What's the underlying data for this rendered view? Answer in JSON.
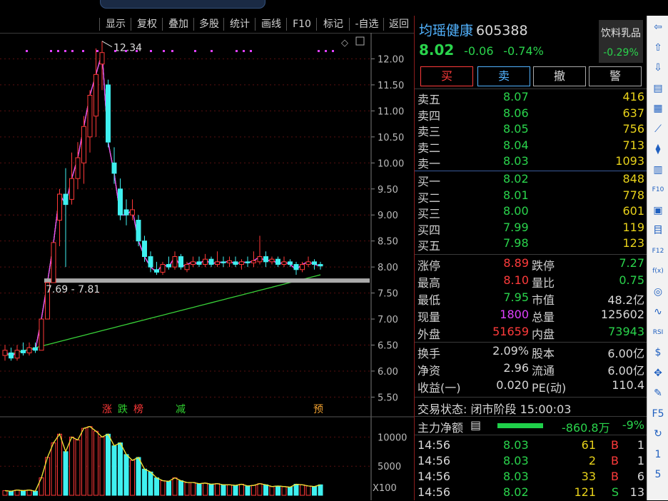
{
  "toolbar": {
    "items": [
      "显示",
      "复权",
      "叠加",
      "多股",
      "统计",
      "画线",
      "F10",
      "标记",
      "-自选",
      "返回"
    ]
  },
  "chart": {
    "max_label": "12.34",
    "range_label": "7.69 - 7.81",
    "price_ticks": [
      "12.00",
      "11.50",
      "11.00",
      "10.50",
      "10.00",
      "9.50",
      "9.00",
      "8.50",
      "8.00",
      "7.50",
      "7.00",
      "6.50",
      "6.00",
      "5.50"
    ],
    "volume_ticks": [
      "10000",
      "5000"
    ],
    "volume_unit": "X100",
    "events": [
      "涨",
      "跌",
      "榜",
      "减",
      "预"
    ]
  },
  "chart_data": {
    "type": "candlestick",
    "ylim": [
      5.3,
      12.5
    ],
    "candles": [
      {
        "o": 6.3,
        "c": 6.4,
        "h": 6.5,
        "l": 6.2,
        "v": 800
      },
      {
        "o": 6.35,
        "c": 6.25,
        "h": 6.45,
        "l": 6.2,
        "v": 700
      },
      {
        "o": 6.25,
        "c": 6.4,
        "h": 6.5,
        "l": 6.2,
        "v": 900
      },
      {
        "o": 6.4,
        "c": 6.35,
        "h": 6.55,
        "l": 6.3,
        "v": 800
      },
      {
        "o": 6.35,
        "c": 6.45,
        "h": 6.55,
        "l": 6.3,
        "v": 900
      },
      {
        "o": 6.45,
        "c": 6.4,
        "h": 6.55,
        "l": 6.35,
        "v": 700
      },
      {
        "o": 6.4,
        "c": 7.0,
        "h": 7.0,
        "l": 6.4,
        "v": 3000
      },
      {
        "o": 7.0,
        "c": 7.7,
        "h": 7.7,
        "l": 7.0,
        "v": 6500
      },
      {
        "o": 7.7,
        "c": 8.47,
        "h": 8.47,
        "l": 7.7,
        "v": 9000
      },
      {
        "o": 8.9,
        "c": 9.4,
        "h": 9.5,
        "l": 8.4,
        "v": 10500
      },
      {
        "o": 9.4,
        "c": 9.2,
        "h": 9.9,
        "l": 8.0,
        "v": 7500
      },
      {
        "o": 9.3,
        "c": 9.7,
        "h": 10.2,
        "l": 9.2,
        "v": 10000
      },
      {
        "o": 9.7,
        "c": 10.1,
        "h": 10.4,
        "l": 9.5,
        "v": 9500
      },
      {
        "o": 10.0,
        "c": 10.7,
        "h": 10.9,
        "l": 9.6,
        "v": 11500
      },
      {
        "o": 10.5,
        "c": 11.3,
        "h": 11.4,
        "l": 10.2,
        "v": 11800
      },
      {
        "o": 10.9,
        "c": 11.7,
        "h": 12.2,
        "l": 10.5,
        "v": 11000
      },
      {
        "o": 11.9,
        "c": 12.12,
        "h": 12.34,
        "l": 11.4,
        "v": 10000
      },
      {
        "o": 11.5,
        "c": 10.4,
        "h": 11.6,
        "l": 10.3,
        "v": 10500
      },
      {
        "o": 10.0,
        "c": 9.8,
        "h": 10.3,
        "l": 9.6,
        "v": 8500
      },
      {
        "o": 9.5,
        "c": 9.0,
        "h": 9.7,
        "l": 8.9,
        "v": 9000
      },
      {
        "o": 9.1,
        "c": 9.0,
        "h": 9.3,
        "l": 8.8,
        "v": 7000
      },
      {
        "o": 9.0,
        "c": 9.1,
        "h": 9.3,
        "l": 8.9,
        "v": 6000
      },
      {
        "o": 8.9,
        "c": 8.5,
        "h": 9.0,
        "l": 8.4,
        "v": 6500
      },
      {
        "o": 8.5,
        "c": 8.2,
        "h": 8.6,
        "l": 8.1,
        "v": 4500
      },
      {
        "o": 8.2,
        "c": 8.0,
        "h": 8.3,
        "l": 7.9,
        "v": 4000
      },
      {
        "o": 7.95,
        "c": 7.9,
        "h": 8.1,
        "l": 7.85,
        "v": 3000
      },
      {
        "o": 7.9,
        "c": 8.05,
        "h": 8.1,
        "l": 7.85,
        "v": 2500
      },
      {
        "o": 8.05,
        "c": 8.0,
        "h": 8.2,
        "l": 7.95,
        "v": 2400
      },
      {
        "o": 8.0,
        "c": 8.2,
        "h": 8.3,
        "l": 7.95,
        "v": 3000
      },
      {
        "o": 8.2,
        "c": 8.0,
        "h": 8.25,
        "l": 7.95,
        "v": 2500
      },
      {
        "o": 7.95,
        "c": 8.05,
        "h": 8.1,
        "l": 7.9,
        "v": 2200
      },
      {
        "o": 8.05,
        "c": 8.1,
        "h": 8.2,
        "l": 8.0,
        "v": 2200
      },
      {
        "o": 8.1,
        "c": 8.05,
        "h": 8.2,
        "l": 8.0,
        "v": 2000
      },
      {
        "o": 8.05,
        "c": 8.15,
        "h": 8.25,
        "l": 8.0,
        "v": 2100
      },
      {
        "o": 8.15,
        "c": 8.05,
        "h": 8.2,
        "l": 8.0,
        "v": 1900
      },
      {
        "o": 8.05,
        "c": 8.1,
        "h": 8.3,
        "l": 8.0,
        "v": 2000
      },
      {
        "o": 8.1,
        "c": 8.08,
        "h": 8.2,
        "l": 8.0,
        "v": 1800
      },
      {
        "o": 8.08,
        "c": 8.12,
        "h": 8.2,
        "l": 8.0,
        "v": 1800
      },
      {
        "o": 8.1,
        "c": 8.05,
        "h": 8.2,
        "l": 8.0,
        "v": 1700
      },
      {
        "o": 8.05,
        "c": 8.1,
        "h": 8.15,
        "l": 7.95,
        "v": 1900
      },
      {
        "o": 8.1,
        "c": 8.08,
        "h": 8.2,
        "l": 8.0,
        "v": 1600
      },
      {
        "o": 8.08,
        "c": 8.12,
        "h": 8.3,
        "l": 8.0,
        "v": 1700
      },
      {
        "o": 8.1,
        "c": 8.2,
        "h": 8.6,
        "l": 8.05,
        "v": 2000
      },
      {
        "o": 8.2,
        "c": 8.1,
        "h": 8.3,
        "l": 8.0,
        "v": 1800
      },
      {
        "o": 8.1,
        "c": 8.15,
        "h": 8.2,
        "l": 8.05,
        "v": 1500
      },
      {
        "o": 8.15,
        "c": 8.05,
        "h": 8.2,
        "l": 8.0,
        "v": 1600
      },
      {
        "o": 8.05,
        "c": 8.1,
        "h": 8.2,
        "l": 8.0,
        "v": 1500
      },
      {
        "o": 8.1,
        "c": 8.05,
        "h": 8.15,
        "l": 8.0,
        "v": 1400
      },
      {
        "o": 8.05,
        "c": 7.95,
        "h": 8.1,
        "l": 7.85,
        "v": 1900
      },
      {
        "o": 7.95,
        "c": 8.05,
        "h": 8.1,
        "l": 7.9,
        "v": 1800
      },
      {
        "o": 8.05,
        "c": 8.1,
        "h": 8.2,
        "l": 8.0,
        "v": 1600
      },
      {
        "o": 8.1,
        "c": 8.05,
        "h": 8.15,
        "l": 7.95,
        "v": 1500
      },
      {
        "o": 8.05,
        "c": 8.02,
        "h": 8.1,
        "l": 7.95,
        "v": 1800
      }
    ]
  },
  "stock": {
    "name": "均瑶健康",
    "code": "605388",
    "price": "8.02",
    "change": "-0.06",
    "pct": "-0.74%",
    "sector_name": "饮料乳品",
    "sector_pct": "-0.29%"
  },
  "actions": {
    "buy": "买",
    "sell": "卖",
    "cancel": "撤",
    "alert": "警"
  },
  "asks": [
    {
      "label": "卖五",
      "price": "8.07",
      "vol": "416"
    },
    {
      "label": "卖四",
      "price": "8.06",
      "vol": "637"
    },
    {
      "label": "卖三",
      "price": "8.05",
      "vol": "756"
    },
    {
      "label": "卖二",
      "price": "8.04",
      "vol": "713"
    },
    {
      "label": "卖一",
      "price": "8.03",
      "vol": "1093"
    }
  ],
  "bids": [
    {
      "label": "买一",
      "price": "8.02",
      "vol": "848"
    },
    {
      "label": "买二",
      "price": "8.01",
      "vol": "778"
    },
    {
      "label": "买三",
      "price": "8.00",
      "vol": "601"
    },
    {
      "label": "买四",
      "price": "7.99",
      "vol": "119"
    },
    {
      "label": "买五",
      "price": "7.98",
      "vol": "123"
    }
  ],
  "stats": [
    {
      "l1": "涨停",
      "v1": "8.89",
      "l2": "跌停",
      "v2": "7.27"
    },
    {
      "l1": "最高",
      "v1": "8.10",
      "l2": "量比",
      "v2": "0.75"
    },
    {
      "l1": "最低",
      "v1": "7.95",
      "l2": "市值",
      "v2": "48.2亿"
    },
    {
      "l1": "现量",
      "v1": "1800",
      "l2": "总量",
      "v2": "125602"
    },
    {
      "l1": "外盘",
      "v1": "51659",
      "l2": "内盘",
      "v2": "73943"
    }
  ],
  "fin": [
    {
      "l1": "换手",
      "v1": "2.09%",
      "l2": "股本",
      "v2": "6.00亿"
    },
    {
      "l1": "净资",
      "v1": "2.96",
      "l2": "流通",
      "v2": "6.00亿"
    },
    {
      "l1": "收益(一)",
      "v1": "0.020",
      "l2": "PE(动)",
      "v2": "110.4"
    }
  ],
  "status": "交易状态: 闭市阶段 15:00:03",
  "main_flow": {
    "label": "主力净额",
    "value": "-860.8万",
    "pct": "-9%"
  },
  "ticks": [
    {
      "t": "14:56",
      "p": "8.03",
      "v": "61",
      "s": "B",
      "n": "1"
    },
    {
      "t": "14:56",
      "p": "8.03",
      "v": "2",
      "s": "B",
      "n": "1"
    },
    {
      "t": "14:56",
      "p": "8.03",
      "v": "33",
      "s": "B",
      "n": "6"
    },
    {
      "t": "14:56",
      "p": "8.02",
      "v": "121",
      "s": "S",
      "n": "13"
    }
  ],
  "sidebar": {
    "icons": [
      "⇦",
      "⇧",
      "⇩",
      "▤",
      "▦",
      "⟋",
      "⧫",
      "▥",
      "F10",
      "▣",
      "目",
      "F12",
      "f(x)",
      "◎",
      "∿",
      "RSI",
      "$",
      "✥",
      "✎",
      "F5",
      "↻",
      "1",
      "5"
    ]
  }
}
